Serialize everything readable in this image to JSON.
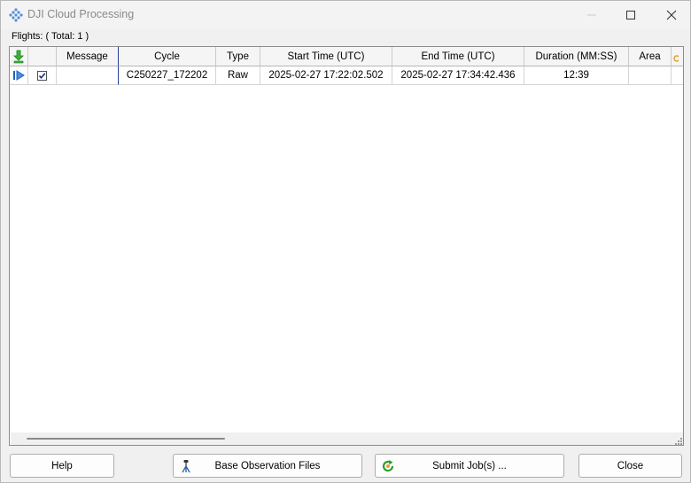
{
  "window": {
    "title": "DJI Cloud Processing",
    "icon": "dji-cloud-icon",
    "controls": {
      "minimize": "minimize-icon",
      "maximize": "maximize-icon",
      "close": "close-icon"
    }
  },
  "flights": {
    "label": "Flights: ( Total: 1 )"
  },
  "grid": {
    "columns": [
      "",
      "",
      "Message",
      "Cycle",
      "Type",
      "Start Time (UTC)",
      "End Time (UTC)",
      "Duration (MM:SS)",
      "Area"
    ],
    "rows": [
      {
        "checked": true,
        "message": "",
        "cycle": "C250227_172202",
        "type": "Raw",
        "start": "2025-02-27 17:22:02.502",
        "end": "2025-02-27 17:34:42.436",
        "duration": "12:39",
        "area": ""
      }
    ]
  },
  "buttons": {
    "help": "Help",
    "base_obs": "Base Observation Files",
    "submit": "Submit Job(s) ...",
    "close": "Close"
  },
  "colors": {
    "accent_green": "#2e9e2e",
    "selection_border": "#2a3a9e",
    "play_blue": "#1f5fbf"
  }
}
